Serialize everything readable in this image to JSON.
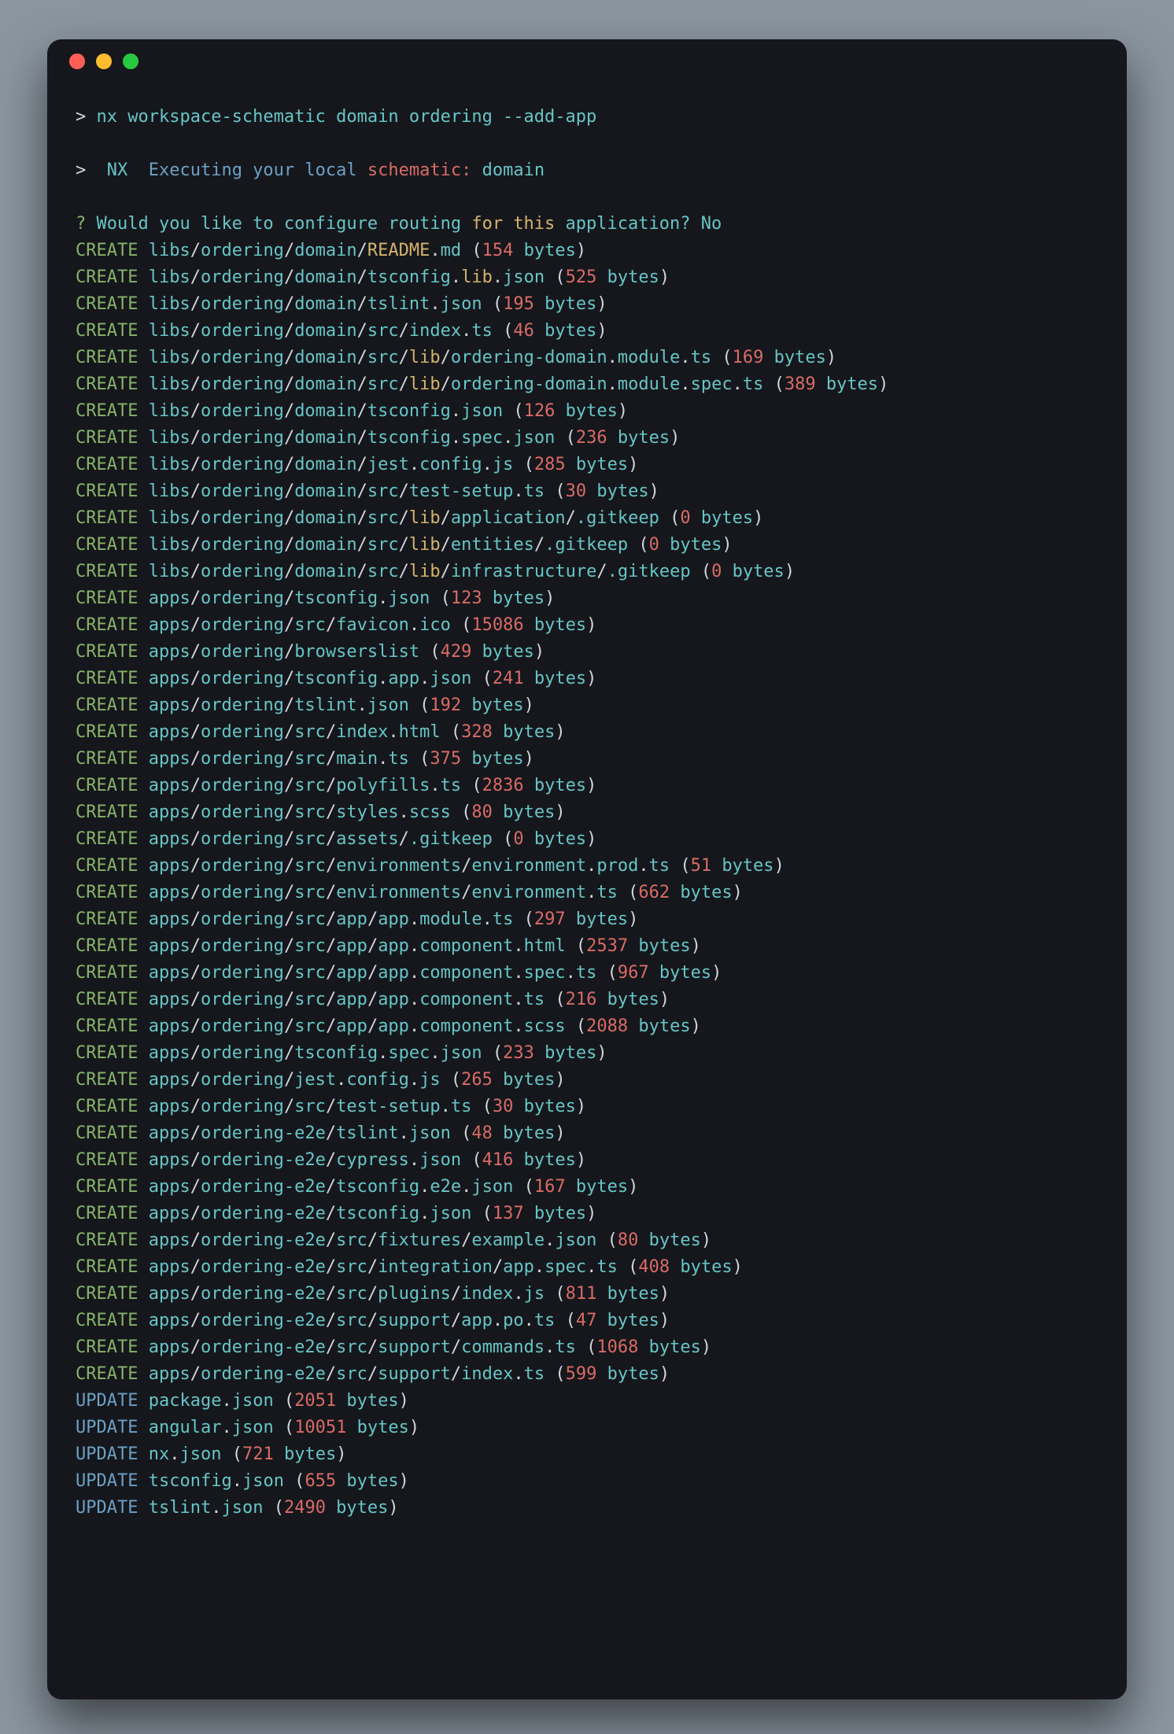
{
  "command": {
    "prompt": ">",
    "raw": "nx workspace-schematic domain ordering --add-app"
  },
  "nx_line": {
    "prompt": ">",
    "label": "NX",
    "prefix": "Executing your local",
    "schematic_word": "schematic:",
    "schematic_name": "domain"
  },
  "question": {
    "mark": "?",
    "text_a": "Would you like to configure routing",
    "for_word": "for",
    "text_b": "this application?",
    "answer": "No"
  },
  "entries": [
    {
      "action": "CREATE",
      "path": [
        [
          "libs",
          "ordering",
          "domain",
          "README"
        ],
        [
          ".",
          "md"
        ]
      ],
      "size": 154
    },
    {
      "action": "CREATE",
      "path": [
        [
          "libs",
          "ordering",
          "domain",
          "tsconfig"
        ],
        [
          ".",
          "lib"
        ],
        [
          ".",
          "json"
        ]
      ],
      "size": 525
    },
    {
      "action": "CREATE",
      "path": [
        [
          "libs",
          "ordering",
          "domain",
          "tslint"
        ],
        [
          ".",
          "json"
        ]
      ],
      "size": 195
    },
    {
      "action": "CREATE",
      "path": [
        [
          "libs",
          "ordering",
          "domain",
          "src",
          "index"
        ],
        [
          ".",
          "ts"
        ]
      ],
      "size": 46
    },
    {
      "action": "CREATE",
      "path": [
        [
          "libs",
          "ordering",
          "domain",
          "src",
          "lib",
          "ordering-domain"
        ],
        [
          ".",
          "module"
        ],
        [
          ".",
          "ts"
        ]
      ],
      "size": 169
    },
    {
      "action": "CREATE",
      "path": [
        [
          "libs",
          "ordering",
          "domain",
          "src",
          "lib",
          "ordering-domain"
        ],
        [
          ".",
          "module"
        ],
        [
          ".",
          "spec"
        ],
        [
          ".",
          "ts"
        ]
      ],
      "size": 389
    },
    {
      "action": "CREATE",
      "path": [
        [
          "libs",
          "ordering",
          "domain",
          "tsconfig"
        ],
        [
          ".",
          "json"
        ]
      ],
      "size": 126
    },
    {
      "action": "CREATE",
      "path": [
        [
          "libs",
          "ordering",
          "domain",
          "tsconfig"
        ],
        [
          ".",
          "spec"
        ],
        [
          ".",
          "json"
        ]
      ],
      "size": 236
    },
    {
      "action": "CREATE",
      "path": [
        [
          "libs",
          "ordering",
          "domain",
          "jest"
        ],
        [
          ".",
          "config"
        ],
        [
          ".",
          "js"
        ]
      ],
      "size": 285
    },
    {
      "action": "CREATE",
      "path": [
        [
          "libs",
          "ordering",
          "domain",
          "src",
          "test-setup"
        ],
        [
          ".",
          "ts"
        ]
      ],
      "size": 30
    },
    {
      "action": "CREATE",
      "path": [
        [
          "libs",
          "ordering",
          "domain",
          "src",
          "lib",
          "application",
          "."
        ],
        [
          "gitkeep"
        ]
      ],
      "size": 0
    },
    {
      "action": "CREATE",
      "path": [
        [
          "libs",
          "ordering",
          "domain",
          "src",
          "lib",
          "entities",
          "."
        ],
        [
          "gitkeep"
        ]
      ],
      "size": 0
    },
    {
      "action": "CREATE",
      "path": [
        [
          "libs",
          "ordering",
          "domain",
          "src",
          "lib",
          "infrastructure",
          "."
        ],
        [
          "gitkeep"
        ]
      ],
      "size": 0
    },
    {
      "action": "CREATE",
      "path": [
        [
          "apps",
          "ordering",
          "tsconfig"
        ],
        [
          ".",
          "json"
        ]
      ],
      "size": 123
    },
    {
      "action": "CREATE",
      "path": [
        [
          "apps",
          "ordering",
          "src",
          "favicon"
        ],
        [
          ".",
          "ico"
        ]
      ],
      "size": 15086
    },
    {
      "action": "CREATE",
      "path": [
        [
          "apps",
          "ordering",
          "browserslist"
        ]
      ],
      "size": 429
    },
    {
      "action": "CREATE",
      "path": [
        [
          "apps",
          "ordering",
          "tsconfig"
        ],
        [
          ".",
          "app"
        ],
        [
          ".",
          "json"
        ]
      ],
      "size": 241
    },
    {
      "action": "CREATE",
      "path": [
        [
          "apps",
          "ordering",
          "tslint"
        ],
        [
          ".",
          "json"
        ]
      ],
      "size": 192
    },
    {
      "action": "CREATE",
      "path": [
        [
          "apps",
          "ordering",
          "src",
          "index"
        ],
        [
          ".",
          "html"
        ]
      ],
      "size": 328
    },
    {
      "action": "CREATE",
      "path": [
        [
          "apps",
          "ordering",
          "src",
          "main"
        ],
        [
          ".",
          "ts"
        ]
      ],
      "size": 375
    },
    {
      "action": "CREATE",
      "path": [
        [
          "apps",
          "ordering",
          "src",
          "polyfills"
        ],
        [
          ".",
          "ts"
        ]
      ],
      "size": 2836
    },
    {
      "action": "CREATE",
      "path": [
        [
          "apps",
          "ordering",
          "src",
          "styles"
        ],
        [
          ".",
          "scss"
        ]
      ],
      "size": 80
    },
    {
      "action": "CREATE",
      "path": [
        [
          "apps",
          "ordering",
          "src",
          "assets",
          "."
        ],
        [
          "gitkeep"
        ]
      ],
      "size": 0
    },
    {
      "action": "CREATE",
      "path": [
        [
          "apps",
          "ordering",
          "src",
          "environments",
          "environment"
        ],
        [
          ".",
          "prod"
        ],
        [
          ".",
          "ts"
        ]
      ],
      "size": 51
    },
    {
      "action": "CREATE",
      "path": [
        [
          "apps",
          "ordering",
          "src",
          "environments",
          "environment"
        ],
        [
          ".",
          "ts"
        ]
      ],
      "size": 662
    },
    {
      "action": "CREATE",
      "path": [
        [
          "apps",
          "ordering",
          "src",
          "app",
          "app"
        ],
        [
          ".",
          "module"
        ],
        [
          ".",
          "ts"
        ]
      ],
      "size": 297
    },
    {
      "action": "CREATE",
      "path": [
        [
          "apps",
          "ordering",
          "src",
          "app",
          "app"
        ],
        [
          ".",
          "component"
        ],
        [
          ".",
          "html"
        ]
      ],
      "size": 2537
    },
    {
      "action": "CREATE",
      "path": [
        [
          "apps",
          "ordering",
          "src",
          "app",
          "app"
        ],
        [
          ".",
          "component"
        ],
        [
          ".",
          "spec"
        ],
        [
          ".",
          "ts"
        ]
      ],
      "size": 967
    },
    {
      "action": "CREATE",
      "path": [
        [
          "apps",
          "ordering",
          "src",
          "app",
          "app"
        ],
        [
          ".",
          "component"
        ],
        [
          ".",
          "ts"
        ]
      ],
      "size": 216
    },
    {
      "action": "CREATE",
      "path": [
        [
          "apps",
          "ordering",
          "src",
          "app",
          "app"
        ],
        [
          ".",
          "component"
        ],
        [
          ".",
          "scss"
        ]
      ],
      "size": 2088
    },
    {
      "action": "CREATE",
      "path": [
        [
          "apps",
          "ordering",
          "tsconfig"
        ],
        [
          ".",
          "spec"
        ],
        [
          ".",
          "json"
        ]
      ],
      "size": 233
    },
    {
      "action": "CREATE",
      "path": [
        [
          "apps",
          "ordering",
          "jest"
        ],
        [
          ".",
          "config"
        ],
        [
          ".",
          "js"
        ]
      ],
      "size": 265
    },
    {
      "action": "CREATE",
      "path": [
        [
          "apps",
          "ordering",
          "src",
          "test-setup"
        ],
        [
          ".",
          "ts"
        ]
      ],
      "size": 30
    },
    {
      "action": "CREATE",
      "path": [
        [
          "apps",
          "ordering-e2e",
          "tslint"
        ],
        [
          ".",
          "json"
        ]
      ],
      "size": 48
    },
    {
      "action": "CREATE",
      "path": [
        [
          "apps",
          "ordering-e2e",
          "cypress"
        ],
        [
          ".",
          "json"
        ]
      ],
      "size": 416
    },
    {
      "action": "CREATE",
      "path": [
        [
          "apps",
          "ordering-e2e",
          "tsconfig"
        ],
        [
          ".",
          "e2e"
        ],
        [
          ".",
          "json"
        ]
      ],
      "size": 167
    },
    {
      "action": "CREATE",
      "path": [
        [
          "apps",
          "ordering-e2e",
          "tsconfig"
        ],
        [
          ".",
          "json"
        ]
      ],
      "size": 137
    },
    {
      "action": "CREATE",
      "path": [
        [
          "apps",
          "ordering-e2e",
          "src",
          "fixtures",
          "example"
        ],
        [
          ".",
          "json"
        ]
      ],
      "size": 80
    },
    {
      "action": "CREATE",
      "path": [
        [
          "apps",
          "ordering-e2e",
          "src",
          "integration",
          "app"
        ],
        [
          ".",
          "spec"
        ],
        [
          ".",
          "ts"
        ]
      ],
      "size": 408
    },
    {
      "action": "CREATE",
      "path": [
        [
          "apps",
          "ordering-e2e",
          "src",
          "plugins",
          "index"
        ],
        [
          ".",
          "js"
        ]
      ],
      "size": 811
    },
    {
      "action": "CREATE",
      "path": [
        [
          "apps",
          "ordering-e2e",
          "src",
          "support",
          "app"
        ],
        [
          ".",
          "po"
        ],
        [
          ".",
          "ts"
        ]
      ],
      "size": 47
    },
    {
      "action": "CREATE",
      "path": [
        [
          "apps",
          "ordering-e2e",
          "src",
          "support",
          "commands"
        ],
        [
          ".",
          "ts"
        ]
      ],
      "size": 1068
    },
    {
      "action": "CREATE",
      "path": [
        [
          "apps",
          "ordering-e2e",
          "src",
          "support",
          "index"
        ],
        [
          ".",
          "ts"
        ]
      ],
      "size": 599
    },
    {
      "action": "UPDATE",
      "path": [
        [
          "package"
        ],
        [
          ".",
          "json"
        ]
      ],
      "size": 2051
    },
    {
      "action": "UPDATE",
      "path": [
        [
          "angular"
        ],
        [
          ".",
          "json"
        ]
      ],
      "size": 10051
    },
    {
      "action": "UPDATE",
      "path": [
        [
          "nx"
        ],
        [
          ".",
          "json"
        ]
      ],
      "size": 721
    },
    {
      "action": "UPDATE",
      "path": [
        [
          "tsconfig"
        ],
        [
          ".",
          "json"
        ]
      ],
      "size": 655
    },
    {
      "action": "UPDATE",
      "path": [
        [
          "tslint"
        ],
        [
          ".",
          "json"
        ]
      ],
      "size": 2490
    }
  ],
  "bytes_word": "bytes"
}
